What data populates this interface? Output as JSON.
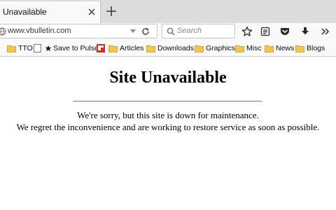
{
  "browser": {
    "tab": {
      "title": "Unavailable"
    },
    "address_bar": {
      "url": "www.vbulletin.com"
    },
    "search_bar": {
      "placeholder": "Search"
    },
    "toolbar_icons": [
      "bookmark-star-icon",
      "reading-list-icon",
      "pocket-icon",
      "download-icon",
      "overflow-chevron-icon"
    ],
    "bookmarks": [
      {
        "label": "TTO",
        "icon": "folder-icon"
      },
      {
        "label": "",
        "icon": "page-icon"
      },
      {
        "label": "Save to Pulse",
        "icon": "star-icon"
      },
      {
        "label": "",
        "icon": "flipboard-icon"
      },
      {
        "label": "Articles",
        "icon": "folder-icon"
      },
      {
        "label": "Downloads",
        "icon": "folder-icon"
      },
      {
        "label": "Graphics",
        "icon": "folder-icon"
      },
      {
        "label": "Misc",
        "icon": "folder-icon"
      },
      {
        "label": "News",
        "icon": "folder-icon"
      },
      {
        "label": "Blogs",
        "icon": "folder-icon"
      }
    ]
  },
  "page": {
    "heading": "Site Unavailable",
    "line1": "We're sorry, but this site is down for maintenance.",
    "line2": "We regret the inconvenience and are working to restore service as soon as possible."
  },
  "colors": {
    "tabstrip": "#dcdcdc",
    "toolbar": "#f9f9fa",
    "folder": "#f3c74f",
    "flipboard": "#e12828"
  }
}
